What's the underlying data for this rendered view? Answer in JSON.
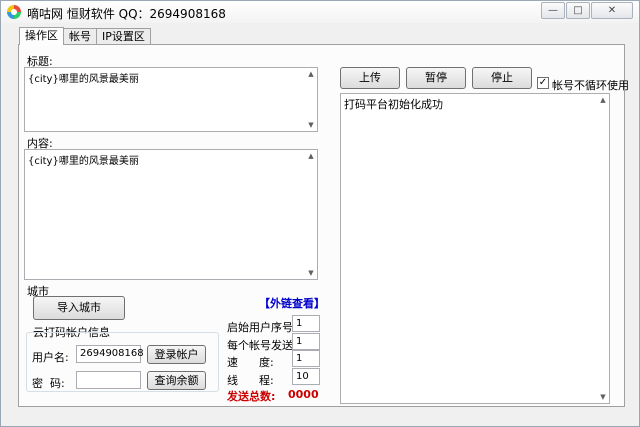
{
  "window": {
    "title": "嘀咕网  恒财软件 QQ：2694908168",
    "controls": {
      "minimize": "—",
      "maximize": "□",
      "close": "✕"
    }
  },
  "tabs": [
    {
      "label": "操作区",
      "active": true
    },
    {
      "label": "帐号",
      "active": false
    },
    {
      "label": "IP设置区",
      "active": false
    }
  ],
  "form": {
    "title_label": "标题:",
    "title_value": "{city}哪里的风景最美丽",
    "content_label": "内容:",
    "content_value": "{city}哪里的风景最美丽",
    "city_label": "城市",
    "import_city_button": "导入城市",
    "external_link": "【外链查看】"
  },
  "captcha": {
    "group_title": "云打码帐户信息",
    "username_label": "用户名:",
    "username_value": "2694908168",
    "password_label": "密  码:",
    "password_value": "",
    "login_button": "登录帐户",
    "balance_button": "查询余额"
  },
  "settings": {
    "start_index_label": "启始用户序号:",
    "start_index_value": "1",
    "per_account_label": "每个帐号发送:",
    "per_account_value": "1",
    "speed_label": "速      度:",
    "speed_value": "1",
    "threads_label": "线      程:",
    "threads_value": "10",
    "total_label": "发送总数:",
    "total_value": "0000"
  },
  "actions": {
    "upload_button": "上传",
    "pause_button": "暂停",
    "stop_button": "停止",
    "no_loop_label": "帐号不循环使用",
    "no_loop_checked": true
  },
  "log": {
    "text": "打码平台初始化成功"
  },
  "colors": {
    "link": "#0000cc",
    "total": "#cc0000"
  }
}
